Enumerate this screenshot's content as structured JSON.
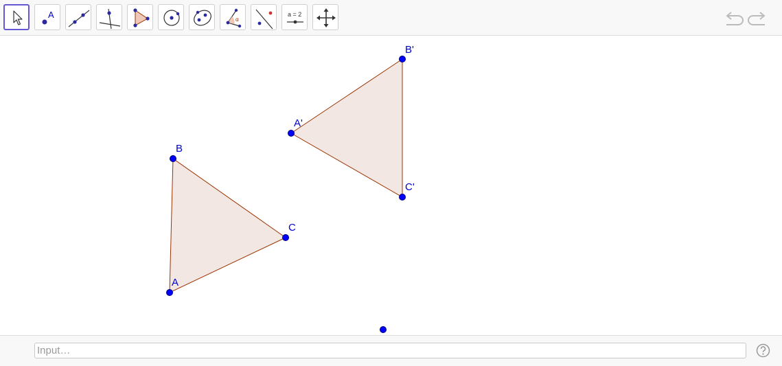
{
  "toolbar": {
    "tools": [
      {
        "name": "move-tool",
        "active": true
      },
      {
        "name": "point-tool",
        "label": "A"
      },
      {
        "name": "line-tool"
      },
      {
        "name": "perpendicular-line-tool"
      },
      {
        "name": "polygon-tool"
      },
      {
        "name": "circle-tool"
      },
      {
        "name": "conic-tool"
      },
      {
        "name": "angle-tool",
        "label": "α"
      },
      {
        "name": "reflect-tool"
      },
      {
        "name": "slider-tool",
        "label": "a = 2"
      },
      {
        "name": "move-graphics-view-tool"
      }
    ],
    "undo_icon": "undo-icon",
    "redo_icon": "redo-icon"
  },
  "construction": {
    "triangle": {
      "points": [
        {
          "label": "A"
        },
        {
          "label": "B"
        },
        {
          "label": "C"
        }
      ]
    },
    "image_triangle": {
      "points": [
        {
          "label": "A'"
        },
        {
          "label": "B'"
        },
        {
          "label": "C'"
        }
      ]
    },
    "colors": {
      "point": "#0000ff",
      "label": "#0000cc",
      "polygon_fill": "#f3e7e3",
      "polygon_stroke": "#993300"
    }
  },
  "input_bar": {
    "placeholder": "Input…",
    "help_icon": "help-icon"
  }
}
